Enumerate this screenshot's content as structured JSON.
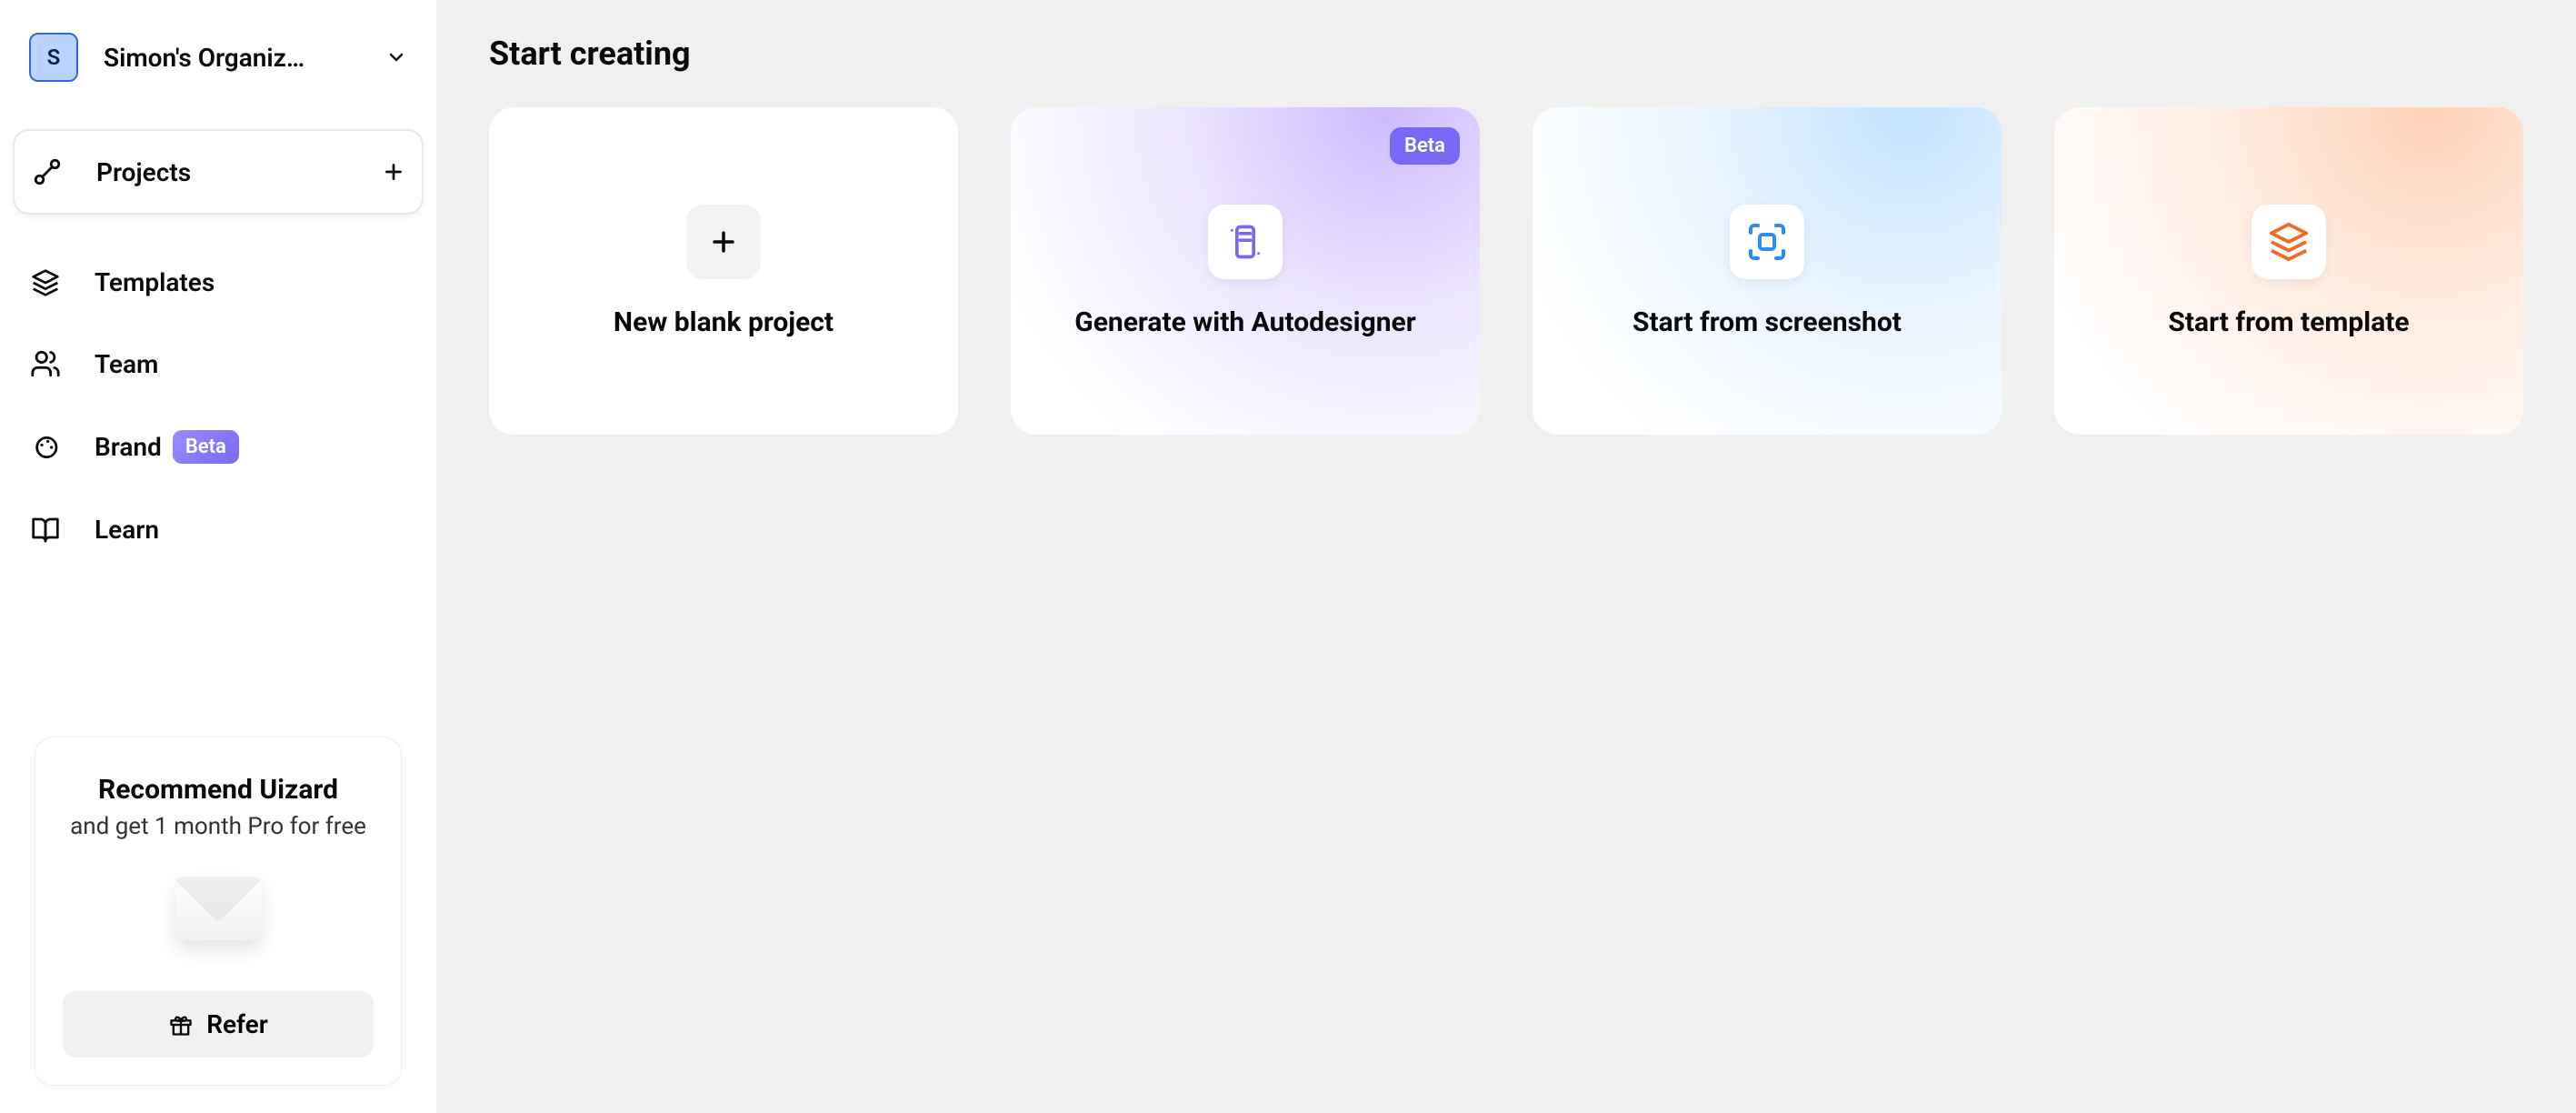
{
  "org": {
    "avatar_letter": "S",
    "name": "Simon's Organiz…"
  },
  "sidebar": {
    "projects": "Projects",
    "templates": "Templates",
    "team": "Team",
    "brand": "Brand",
    "brand_badge": "Beta",
    "learn": "Learn"
  },
  "refer": {
    "title": "Recommend Uizard",
    "subtitle": "and get 1 month Pro for free",
    "button": "Refer"
  },
  "main": {
    "heading": "Start creating",
    "cards": {
      "blank": "New blank project",
      "autodesigner": "Generate with Autodesigner",
      "autodesigner_badge": "Beta",
      "screenshot": "Start from screenshot",
      "template": "Start from template"
    }
  }
}
